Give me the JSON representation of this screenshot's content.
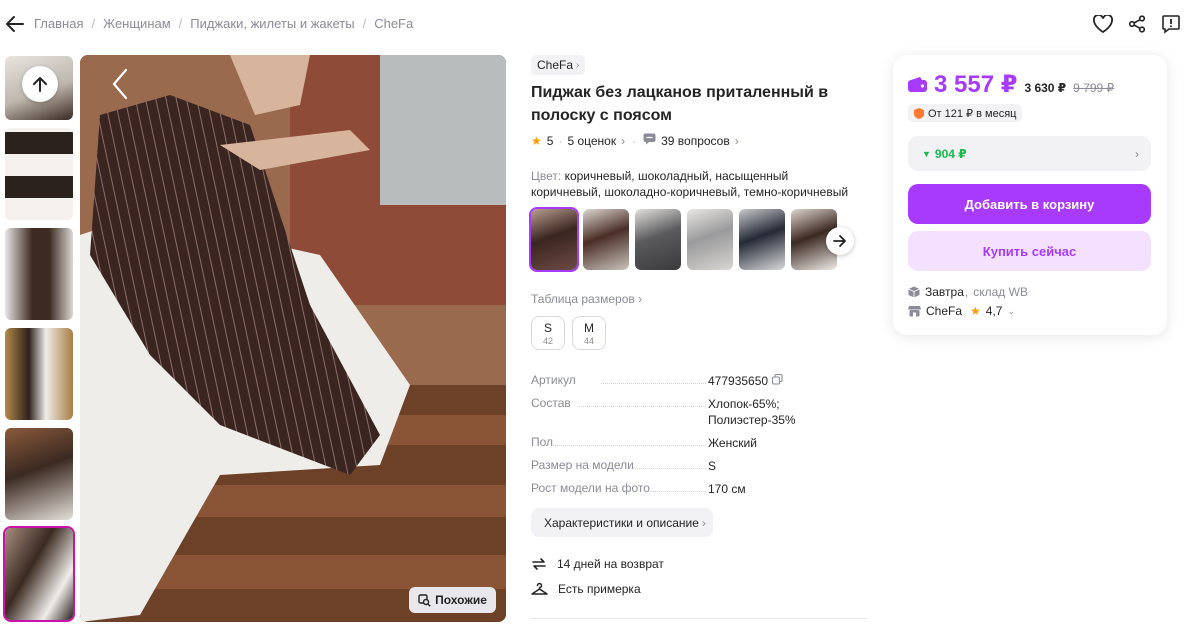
{
  "breadcrumbs": [
    "Главная",
    "Женщинам",
    "Пиджаки, жилеты и жакеты",
    "CheFa"
  ],
  "header_icons": [
    "heart-icon",
    "share-icon",
    "report-icon"
  ],
  "product": {
    "brand": "CheFa",
    "title": "Пиджак без лацканов приталенный в полоску с поясом",
    "rating": "5",
    "reviews": "5 оценок",
    "questions": "39 вопросов",
    "color_label": "Цвет:",
    "color_value": "коричневый, шоколадный, насыщенный коричневый, шоколадно-коричневый, темно-коричневый",
    "size_table": "Таблица размеров",
    "sizes": [
      {
        "size": "S",
        "ru": "42"
      },
      {
        "size": "M",
        "ru": "44"
      }
    ],
    "specs": [
      {
        "key": "Артикул",
        "value": "477935650"
      },
      {
        "key": "Состав",
        "value": "Хлопок-65%; Полиэстер-35%"
      },
      {
        "key": "Пол",
        "value": "Женский"
      },
      {
        "key": "Размер на модели",
        "value": "S"
      },
      {
        "key": "Рост модели на фото",
        "value": "170 см"
      }
    ],
    "characteristics_button": "Характеристики и описание",
    "features": [
      "14 дней на возврат",
      "Есть примерка"
    ],
    "similar_button": "Похожие"
  },
  "buy_card": {
    "price": "3 557 ₽",
    "wallet_price": "3 630 ₽",
    "old_price": "9 799 ₽",
    "installment": "От 121 ₽ в месяц",
    "cashback": "904 ₽",
    "add_to_cart": "Добавить в корзину",
    "buy_now": "Купить сейчас",
    "delivery_day": "Завтра",
    "delivery_rest": "склад WB",
    "seller": "CheFa",
    "seller_rating": "4,7"
  },
  "colors": {
    "accent": "#a73afd",
    "accent_light": "#f3e1ff",
    "green": "#18b94e",
    "star": "#ff9c00"
  }
}
